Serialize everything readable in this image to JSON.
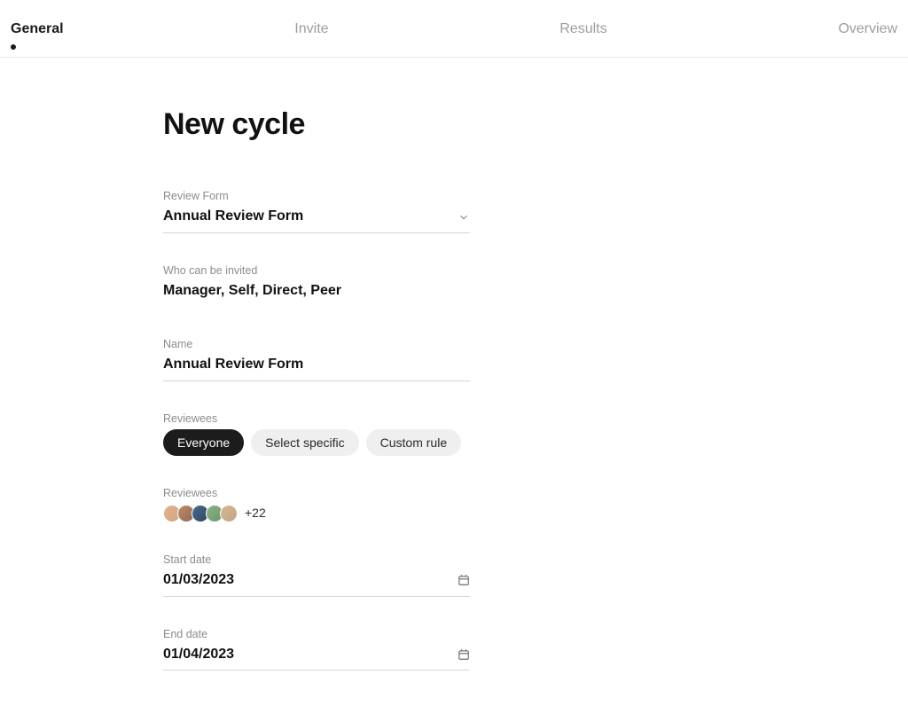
{
  "steps": {
    "items": [
      {
        "label": "General",
        "active": true
      },
      {
        "label": "Invite",
        "active": false
      },
      {
        "label": "Results",
        "active": false
      },
      {
        "label": "Overview",
        "active": false
      }
    ]
  },
  "page": {
    "title": "New cycle"
  },
  "form": {
    "review_form": {
      "label": "Review Form",
      "value": "Annual Review Form"
    },
    "who_can_be_invited": {
      "label": "Who can be invited",
      "value": "Manager, Self, Direct, Peer"
    },
    "name": {
      "label": "Name",
      "value": "Annual Review Form"
    },
    "reviewees_mode": {
      "label": "Reviewees",
      "options": [
        {
          "label": "Everyone",
          "selected": true
        },
        {
          "label": "Select specific",
          "selected": false
        },
        {
          "label": "Custom rule",
          "selected": false
        }
      ]
    },
    "reviewees_list": {
      "label": "Reviewees",
      "visible_avatars": 5,
      "more_label": "+22"
    },
    "start_date": {
      "label": "Start date",
      "value": "01/03/2023"
    },
    "end_date": {
      "label": "End date",
      "value": "01/04/2023"
    }
  },
  "icons": {
    "chevron_down": "chevron-down-icon",
    "calendar": "calendar-icon"
  }
}
